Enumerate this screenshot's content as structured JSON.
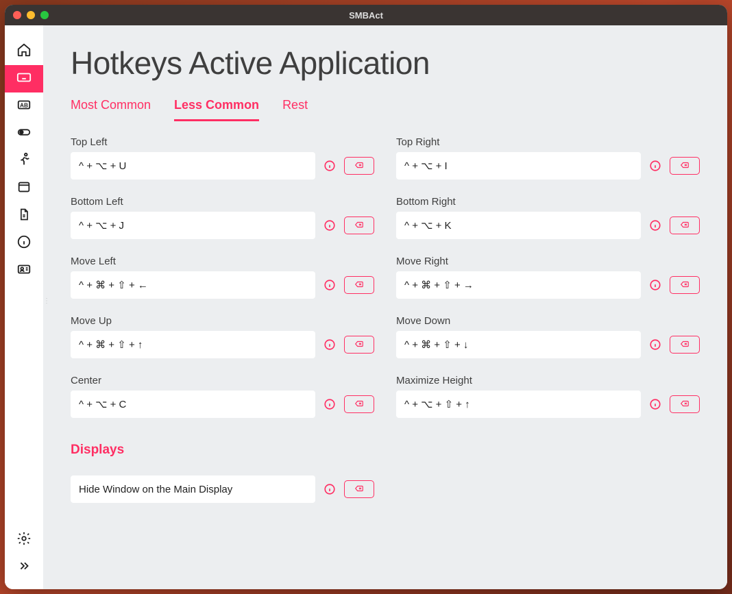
{
  "window": {
    "title": "SMBAct"
  },
  "page": {
    "title": "Hotkeys Active Application"
  },
  "tabs": [
    {
      "label": "Most Common",
      "active": false
    },
    {
      "label": "Less Common",
      "active": true
    },
    {
      "label": "Rest",
      "active": false
    }
  ],
  "hotkeys": {
    "top_left": {
      "label": "Top Left",
      "value": "^ + ⌥ + U"
    },
    "top_right": {
      "label": "Top Right",
      "value": "^ + ⌥ + I"
    },
    "bottom_left": {
      "label": "Bottom Left",
      "value": "^ + ⌥ + J"
    },
    "bottom_right": {
      "label": "Bottom Right",
      "value": "^ + ⌥ + K"
    },
    "move_left": {
      "label": "Move Left",
      "value": "^ + ⌘ + ⇧ + ←"
    },
    "move_right": {
      "label": "Move Right",
      "value": "^ + ⌘ + ⇧ + →"
    },
    "move_up": {
      "label": "Move Up",
      "value": "^ + ⌘ + ⇧ + ↑"
    },
    "move_down": {
      "label": "Move Down",
      "value": "^ + ⌘ + ⇧ + ↓"
    },
    "center": {
      "label": "Center",
      "value": "^ + ⌥ + C"
    },
    "maximize_height": {
      "label": "Maximize Height",
      "value": "^ + ⌥ + ⇧ + ↑"
    }
  },
  "sections": {
    "displays": "Displays"
  },
  "display_option": {
    "label": "Hide Window on the Main Display"
  },
  "colors": {
    "accent": "#ff2e63"
  }
}
